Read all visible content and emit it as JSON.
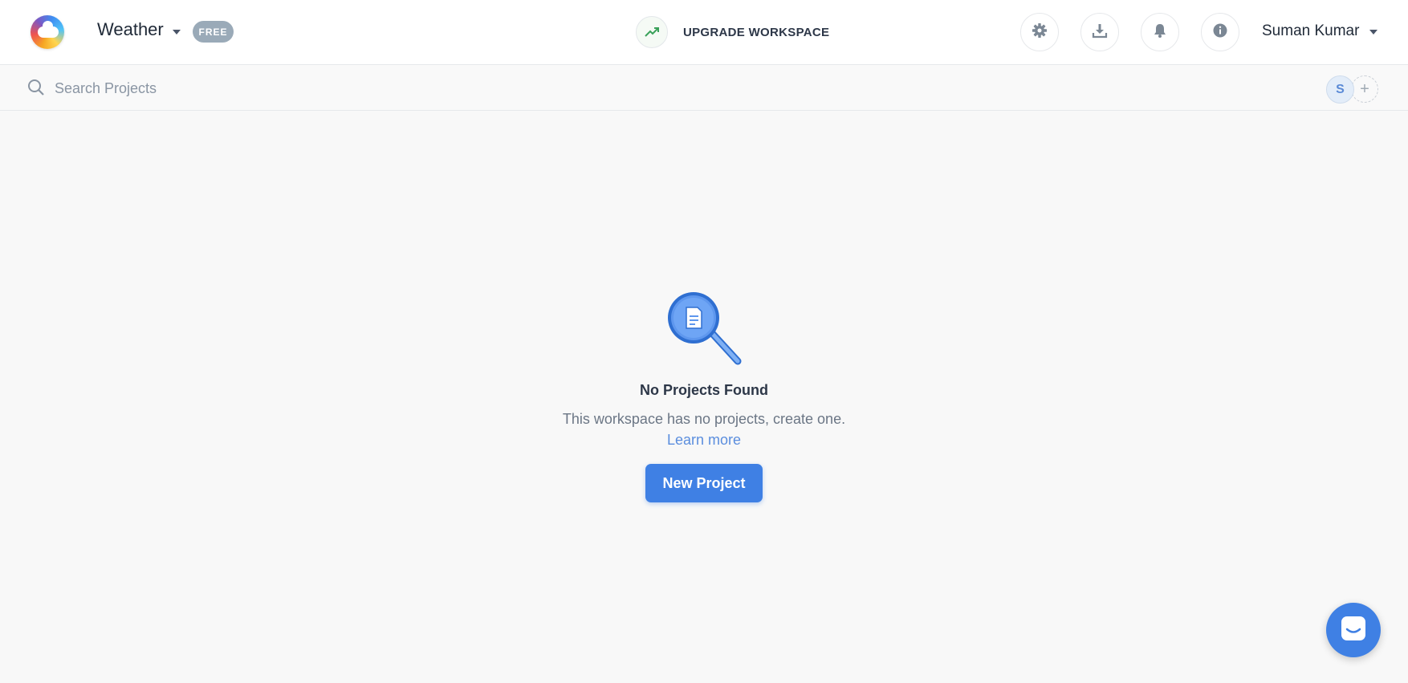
{
  "header": {
    "workspace_name": "Weather",
    "plan_badge": "FREE",
    "upgrade_label": "UPGRADE WORKSPACE",
    "user_name": "Suman Kumar",
    "icons": [
      "settings-icon",
      "download-icon",
      "bell-icon",
      "info-icon"
    ]
  },
  "search": {
    "placeholder": "Search Projects",
    "value": ""
  },
  "members": {
    "avatar_initial": "S",
    "add_symbol": "+"
  },
  "empty_state": {
    "title": "No Projects Found",
    "description": "This workspace has no projects, create one.",
    "learn_more": "Learn more",
    "button_label": "New Project"
  },
  "colors": {
    "accent": "#3f80e4",
    "link": "#5b8ede",
    "badge": "#9aaab8",
    "background": "#f8f8f8"
  }
}
